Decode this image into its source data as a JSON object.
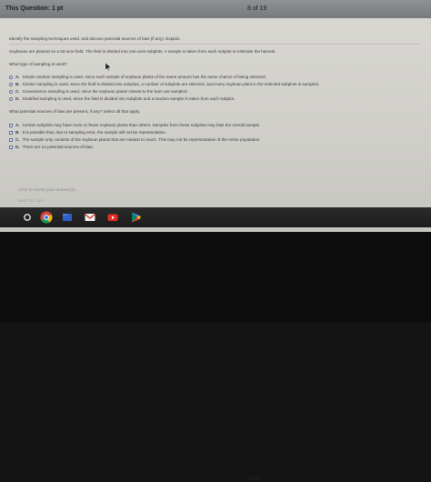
{
  "header": {
    "question_label": "This Question: 1 pt",
    "question_count": "8 of 19"
  },
  "question": {
    "intro": "Identify the sampling techniques used, and discuss potential sources of bias (if any). Explain.",
    "scenario": "Soybeans are planted on a 53-acre field. The field is divided into one-acre subplots. A sample is taken from each subplot to estimate the harvest.",
    "part1_prompt": "What type of sampling is used?",
    "part1_options": [
      {
        "letter": "A.",
        "text": "Simple random sampling is used, since each sample of soybean plants of the same amount has the same chance of being selected."
      },
      {
        "letter": "B.",
        "text": "Cluster sampling is used, since the field is divided into subplots, a number of subplots are selected, and every soybean plant in the selected subplots is sampled."
      },
      {
        "letter": "C.",
        "text": "Convenience sampling is used, since the soybean plants closest to the barn are sampled."
      },
      {
        "letter": "D.",
        "text": "Stratified sampling is used, since the field is divided into subplots and a random sample is taken from each subplot."
      }
    ],
    "part2_prompt": "What potential sources of bias are present, if any? Select all that apply.",
    "part2_options": [
      {
        "letter": "A.",
        "text": "Certain subplots may have more or fewer soybean plants than others. Samples from these subplots may bias the overall sample."
      },
      {
        "letter": "B.",
        "text": "It is possible that, due to sampling error, the sample will not be representative."
      },
      {
        "letter": "C.",
        "text": "The sample only consists of the soybean plants that are easiest to reach. This may not be representative of the entire population."
      },
      {
        "letter": "D.",
        "text": "There are no potential sources of bias."
      }
    ]
  },
  "footer": {
    "hint": "Click to select your answer(s).",
    "back": "Back To Calc"
  },
  "shelf": {
    "icons": [
      "launcher-icon",
      "chrome-icon",
      "gmail-icon",
      "youtube-icon",
      "files-icon",
      "play-store-icon"
    ]
  },
  "bezel": {
    "logo": "acer"
  },
  "colors": {
    "topbar": "#828487",
    "screen_bg": "#d3d2cd",
    "accent_link": "#3b57a5",
    "shelf": "#222222"
  }
}
